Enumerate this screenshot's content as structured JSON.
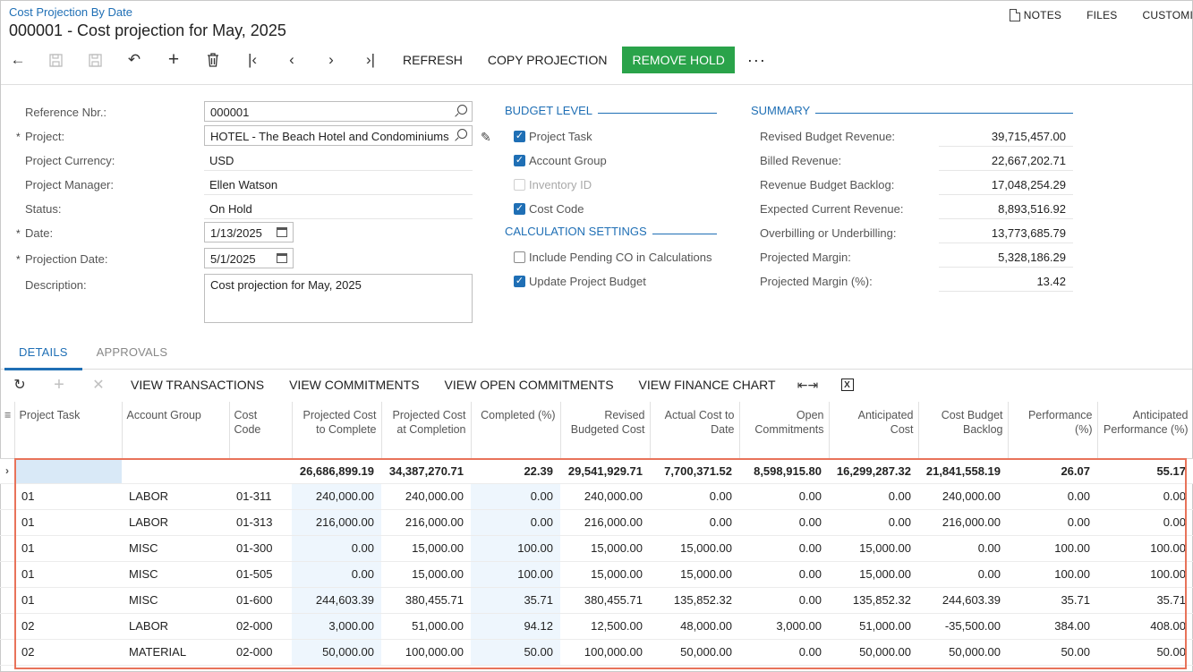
{
  "breadcrumb": "Cost Projection By Date",
  "title": "000001 - Cost projection for May, 2025",
  "top_links": {
    "notes": "NOTES",
    "files": "FILES",
    "customization": "CUSTOMI"
  },
  "toolbar": {
    "refresh": "REFRESH",
    "copy_projection": "COPY PROJECTION",
    "remove_hold": "REMOVE HOLD",
    "more": "···"
  },
  "form": {
    "reference_nbr": {
      "label": "Reference Nbr.:",
      "value": "000001"
    },
    "project": {
      "label": "Project:",
      "value": "HOTEL - The Beach Hotel and Condominiums"
    },
    "project_currency": {
      "label": "Project Currency:",
      "value": "USD"
    },
    "project_manager": {
      "label": "Project Manager:",
      "value": "Ellen Watson"
    },
    "status": {
      "label": "Status:",
      "value": "On Hold"
    },
    "date": {
      "label": "Date:",
      "value": "1/13/2025"
    },
    "projection_date": {
      "label": "Projection Date:",
      "value": "5/1/2025"
    },
    "description": {
      "label": "Description:",
      "value": "Cost projection for May, 2025"
    }
  },
  "budget_level": {
    "title": "BUDGET LEVEL",
    "items": [
      {
        "label": "Project Task",
        "checked": true,
        "disabled": false
      },
      {
        "label": "Account Group",
        "checked": true,
        "disabled": false
      },
      {
        "label": "Inventory ID",
        "checked": false,
        "disabled": true
      },
      {
        "label": "Cost Code",
        "checked": true,
        "disabled": false
      }
    ]
  },
  "calculation_settings": {
    "title": "CALCULATION SETTINGS",
    "items": [
      {
        "label": "Include Pending CO in Calculations",
        "checked": false
      },
      {
        "label": "Update Project Budget",
        "checked": true
      }
    ]
  },
  "summary": {
    "title": "SUMMARY",
    "items": [
      {
        "label": "Revised Budget Revenue:",
        "value": "39,715,457.00"
      },
      {
        "label": "Billed Revenue:",
        "value": "22,667,202.71"
      },
      {
        "label": "Revenue Budget Backlog:",
        "value": "17,048,254.29"
      },
      {
        "label": "Expected Current Revenue:",
        "value": "8,893,516.92"
      },
      {
        "label": "Overbilling or Underbilling:",
        "value": "13,773,685.79"
      },
      {
        "label": "Projected Margin:",
        "value": "5,328,186.29"
      },
      {
        "label": "Projected Margin (%):",
        "value": "13.42"
      }
    ]
  },
  "tabs": [
    {
      "label": "DETAILS"
    },
    {
      "label": "APPROVALS"
    }
  ],
  "grid_toolbar": {
    "view_transactions": "VIEW TRANSACTIONS",
    "view_commitments": "VIEW COMMITMENTS",
    "view_open_commitments": "VIEW OPEN COMMITMENTS",
    "view_finance_chart": "VIEW FINANCE CHART"
  },
  "grid": {
    "columns": [
      "Project Task",
      "Account Group",
      "Cost Code",
      "Projected Cost to Complete",
      "Projected Cost at Completion",
      "Completed (%)",
      "Revised Budgeted Cost",
      "Actual Cost to Date",
      "Open Commitments",
      "Anticipated Cost",
      "Cost Budget Backlog",
      "Performance (%)",
      "Anticipated Performance (%)"
    ],
    "total": [
      "",
      "",
      "",
      "26,686,899.19",
      "34,387,270.71",
      "22.39",
      "29,541,929.71",
      "7,700,371.52",
      "8,598,915.80",
      "16,299,287.32",
      "21,841,558.19",
      "26.07",
      "55.17"
    ],
    "rows": [
      [
        "01",
        "LABOR",
        "01-311",
        "240,000.00",
        "240,000.00",
        "0.00",
        "240,000.00",
        "0.00",
        "0.00",
        "0.00",
        "240,000.00",
        "0.00",
        "0.00"
      ],
      [
        "01",
        "LABOR",
        "01-313",
        "216,000.00",
        "216,000.00",
        "0.00",
        "216,000.00",
        "0.00",
        "0.00",
        "0.00",
        "216,000.00",
        "0.00",
        "0.00"
      ],
      [
        "01",
        "MISC",
        "01-300",
        "0.00",
        "15,000.00",
        "100.00",
        "15,000.00",
        "15,000.00",
        "0.00",
        "15,000.00",
        "0.00",
        "100.00",
        "100.00"
      ],
      [
        "01",
        "MISC",
        "01-505",
        "0.00",
        "15,000.00",
        "100.00",
        "15,000.00",
        "15,000.00",
        "0.00",
        "15,000.00",
        "0.00",
        "100.00",
        "100.00"
      ],
      [
        "01",
        "MISC",
        "01-600",
        "244,603.39",
        "380,455.71",
        "35.71",
        "380,455.71",
        "135,852.32",
        "0.00",
        "135,852.32",
        "244,603.39",
        "35.71",
        "35.71"
      ],
      [
        "02",
        "LABOR",
        "02-000",
        "3,000.00",
        "51,000.00",
        "94.12",
        "12,500.00",
        "48,000.00",
        "3,000.00",
        "51,000.00",
        "-35,500.00",
        "384.00",
        "408.00"
      ],
      [
        "02",
        "MATERIAL",
        "02-000",
        "50,000.00",
        "100,000.00",
        "50.00",
        "100,000.00",
        "50,000.00",
        "0.00",
        "50,000.00",
        "50,000.00",
        "50.00",
        "50.00"
      ]
    ]
  }
}
